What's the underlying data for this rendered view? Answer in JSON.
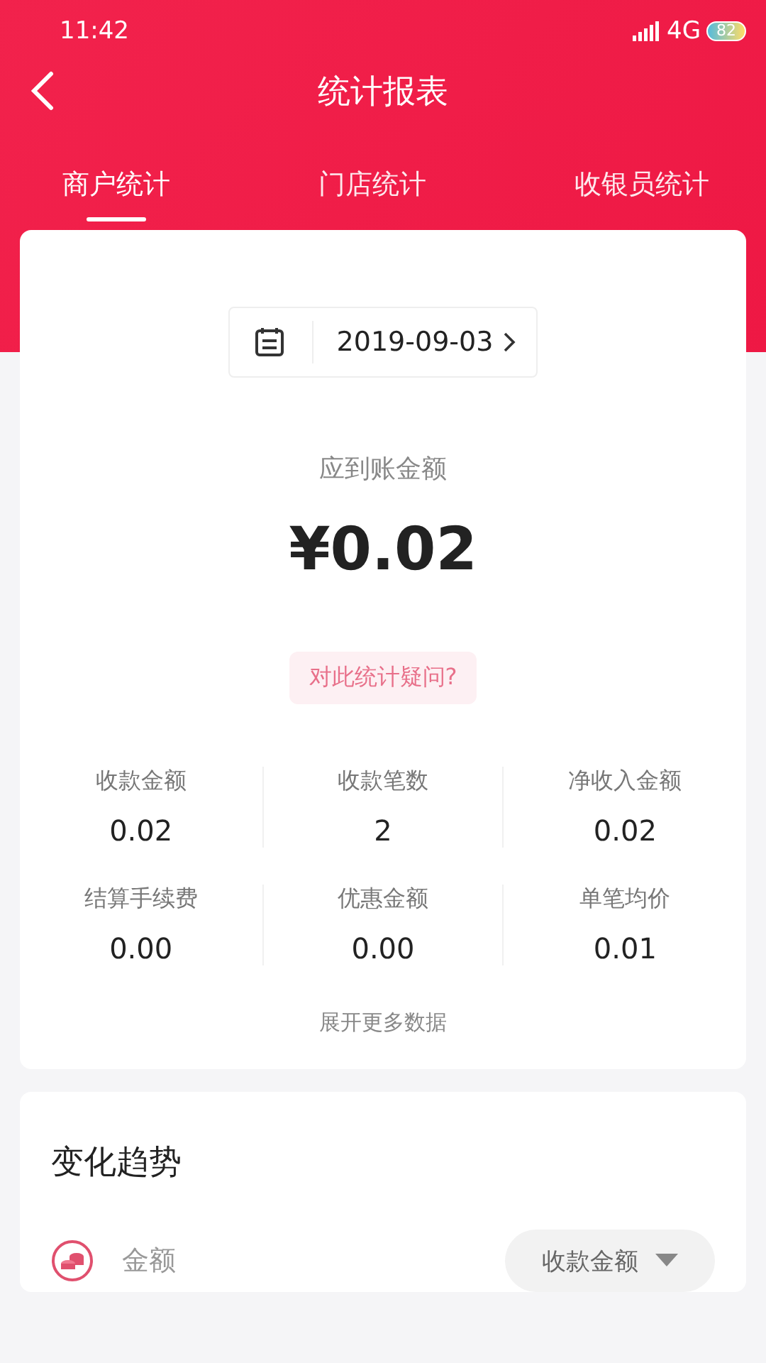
{
  "status_bar": {
    "time": "11:42",
    "network": "4G",
    "battery": "82"
  },
  "header": {
    "title": "统计报表"
  },
  "tabs": [
    {
      "label": "商户统计",
      "selected": true
    },
    {
      "label": "门店统计",
      "selected": false
    },
    {
      "label": "收银员统计",
      "selected": false
    }
  ],
  "summary": {
    "date": "2019-09-03",
    "amount_label": "应到账金额",
    "amount": "¥0.02",
    "question": "对此统计疑问?",
    "stats": [
      {
        "label": "收款金额",
        "value": "0.02"
      },
      {
        "label": "收款笔数",
        "value": "2"
      },
      {
        "label": "净收入金额",
        "value": "0.02"
      },
      {
        "label": "结算手续费",
        "value": "0.00"
      },
      {
        "label": "优惠金额",
        "value": "0.00"
      },
      {
        "label": "单笔均价",
        "value": "0.01"
      }
    ],
    "expand": "展开更多数据"
  },
  "trend": {
    "title": "变化趋势",
    "legend": "金额",
    "dropdown": "收款金额"
  }
}
